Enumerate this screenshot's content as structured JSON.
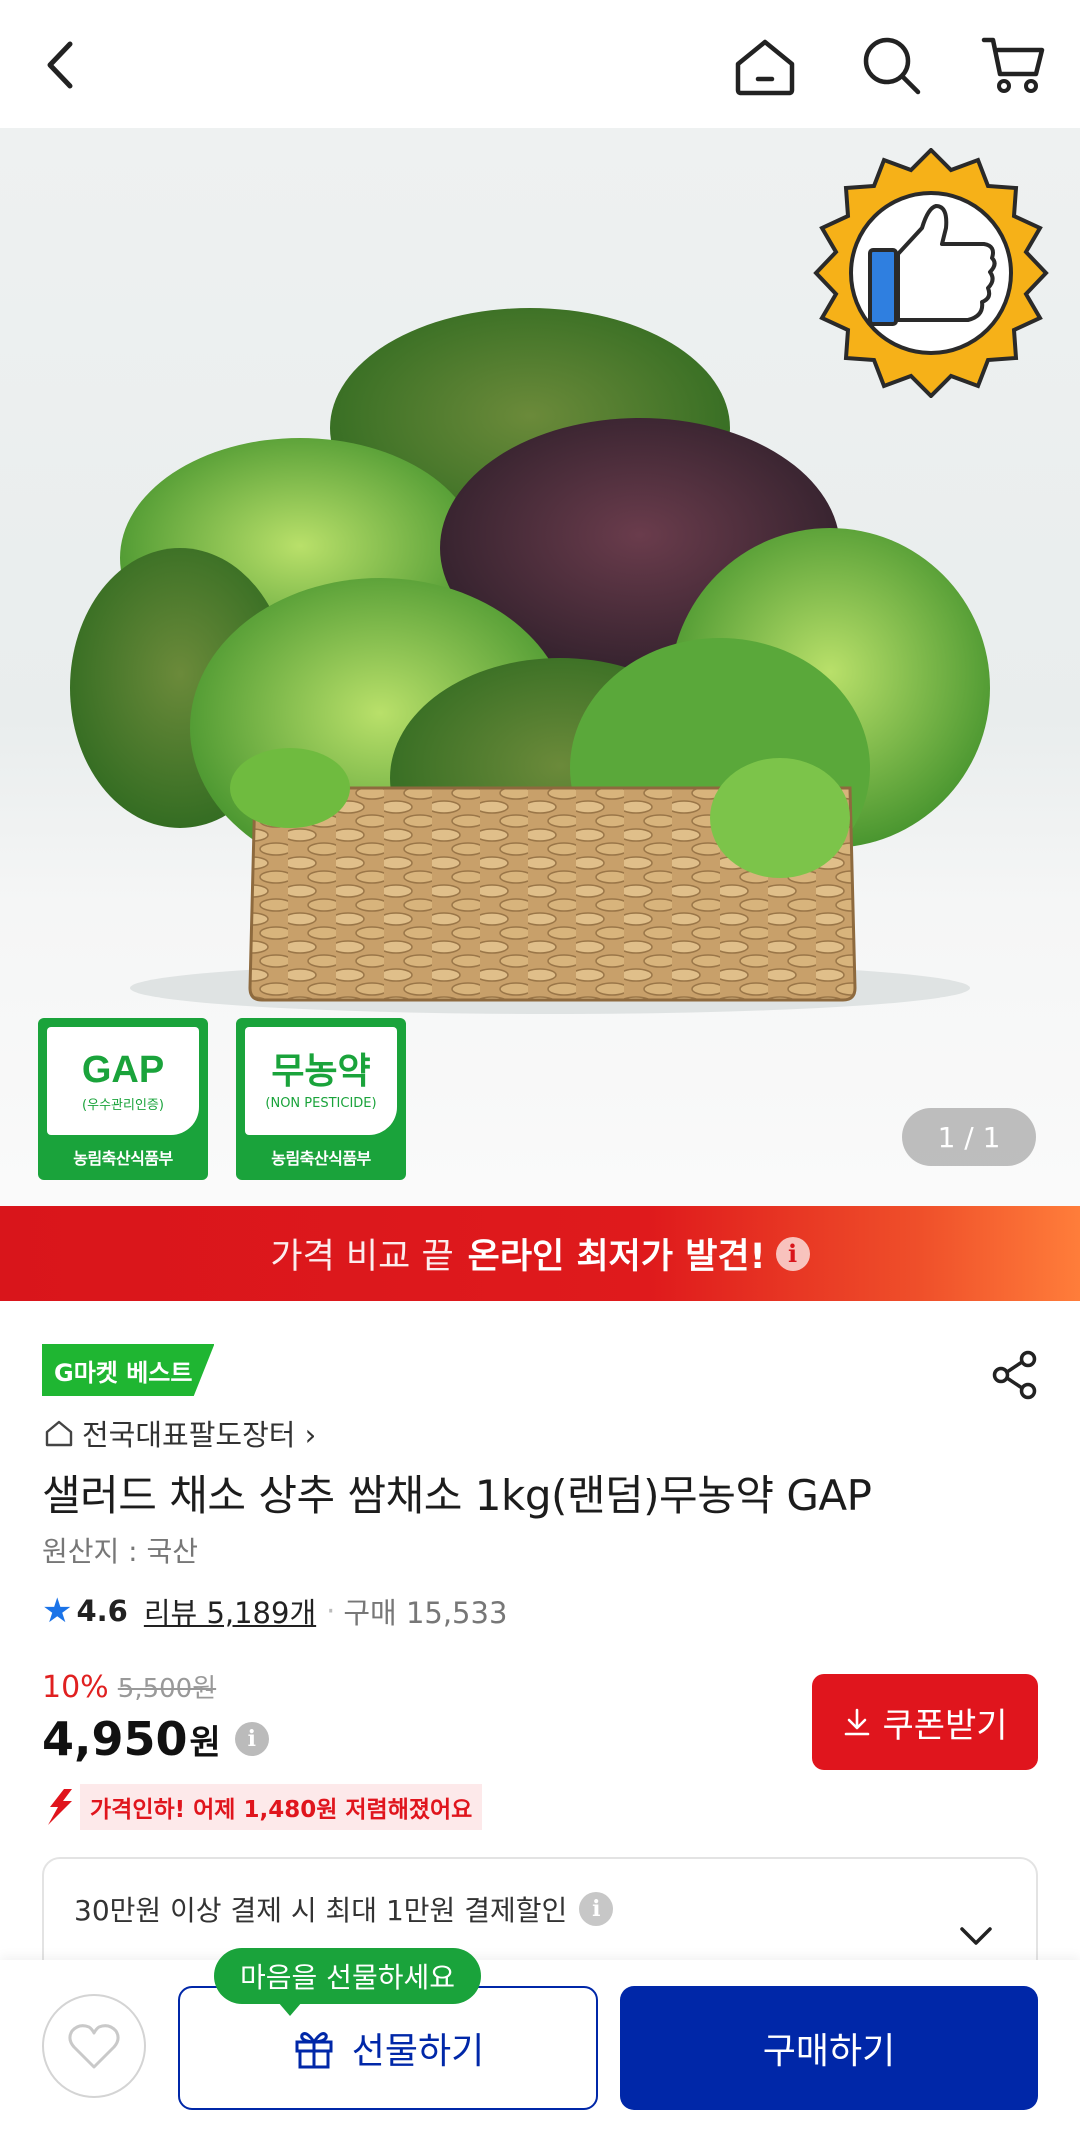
{
  "header": {
    "back_icon": "chevron-left-icon",
    "home_icon": "home-icon",
    "search_icon": "search-icon",
    "cart_icon": "cart-icon"
  },
  "hero": {
    "badge_icon": "thumbs-up-badge-icon",
    "certs": [
      {
        "big": "GAP",
        "small": "(우수관리인증)",
        "foot": "농림축산식품부"
      },
      {
        "big": "무농약",
        "small": "(NON PESTICIDE)",
        "foot": "농림축산식품부"
      }
    ],
    "pager": "1 / 1"
  },
  "promo": {
    "pre": "가격 비교 끝",
    "strong": "온라인 최저가 발견!",
    "info_icon": "i"
  },
  "product": {
    "best_badge": "G마켓 베스트",
    "store": "전국대표팔도장터 ›",
    "title": "샐러드 채소 상추 쌈채소 1kg(랜덤)무농약 GAP",
    "origin": "원산지 : 국산",
    "rating": "4.6",
    "review": "리뷰 5,189개",
    "purchases": "구매 15,533",
    "discount": "10%",
    "original_price": "5,500원",
    "price": "4,950",
    "price_unit": "원",
    "price_drop": "가격인하! 어제 1,480원 저렴해졌어요",
    "coupon_button": "쿠폰받기"
  },
  "benefit": {
    "text": "30만원 이상 결제 시 최대 1만원 결제할인"
  },
  "bottom": {
    "tooltip": "마음을 선물하세요",
    "gift_button": "선물하기",
    "buy_button": "구매하기"
  },
  "colors": {
    "accent_blue": "#0027a8",
    "accent_red": "#e0151d",
    "accent_green": "#1aa33b"
  }
}
